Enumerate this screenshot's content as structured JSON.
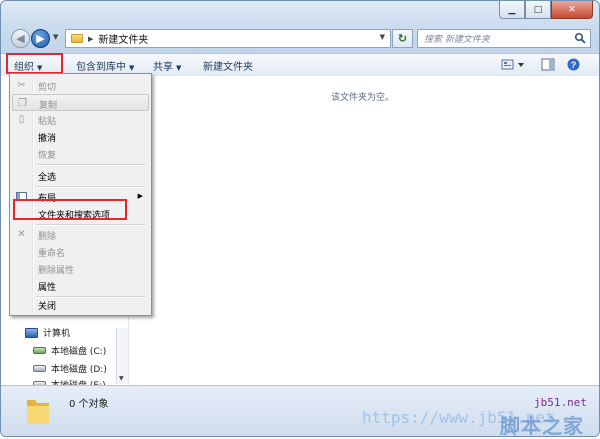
{
  "address_bar": {
    "current_folder": "新建文件夹",
    "search_placeholder": "搜索 新建文件夹"
  },
  "toolbar": {
    "organize": "组织",
    "include_in_library": "包含到库中",
    "share": "共享",
    "new_folder": "新建文件夹"
  },
  "content": {
    "empty_message": "该文件夹为空。"
  },
  "menu": {
    "items": [
      {
        "label": "剪切",
        "enabled": false,
        "icon": "scissors-icon"
      },
      {
        "label": "复制",
        "enabled": false,
        "icon": "copy-icon"
      },
      {
        "label": "粘贴",
        "enabled": false,
        "icon": "paste-icon"
      },
      {
        "label": "撤消",
        "enabled": true
      },
      {
        "label": "恢复",
        "enabled": false
      },
      {
        "label": "全选",
        "enabled": true
      },
      {
        "label": "布局",
        "enabled": true,
        "icon": "layout-icon",
        "submenu": true
      },
      {
        "label": "文件夹和搜索选项",
        "enabled": true
      },
      {
        "label": "删除",
        "enabled": false,
        "icon": "delete-icon"
      },
      {
        "label": "重命名",
        "enabled": false
      },
      {
        "label": "删除属性",
        "enabled": false
      },
      {
        "label": "属性",
        "enabled": true
      },
      {
        "label": "关闭",
        "enabled": true
      }
    ]
  },
  "nav_tree": {
    "items": [
      {
        "label": "计算机",
        "icon": "computer-icon"
      },
      {
        "label": "本地磁盘 (C:)",
        "icon": "system-drive-icon"
      },
      {
        "label": "本地磁盘 (D:)",
        "icon": "drive-icon"
      },
      {
        "label": "本地磁盘 (E:)",
        "icon": "drive-icon"
      }
    ]
  },
  "status": {
    "item_count": "0 个对象"
  },
  "watermark": {
    "url": "jb51.net",
    "brand": "脚本之家",
    "faded_url": "https://www.jb51.net"
  },
  "colors": {
    "highlight": "#e0282d",
    "window_frame": "#6f8fb3",
    "toolbar_text": "#1e395b"
  }
}
